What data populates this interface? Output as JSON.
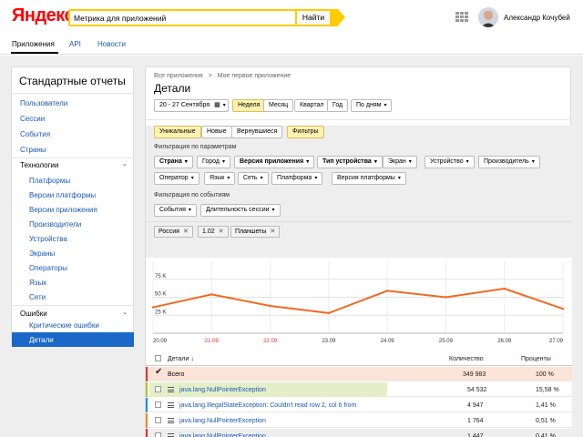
{
  "header": {
    "logo": "Яндекс",
    "search_value": "Метрика для приложений",
    "search_button": "Найти",
    "user_name": "Александр Кочубей"
  },
  "subnav": {
    "items": [
      "Приложения",
      "API",
      "Новости"
    ]
  },
  "sidebar": {
    "title": "Стандартные отчеты",
    "items": [
      "Пользователи",
      "Сессии",
      "События",
      "Страны"
    ],
    "group1": "Технологии",
    "group1_items": [
      "Платформы",
      "Версии платформы",
      "Версии приложения",
      "Производители",
      "Устройства",
      "Экраны",
      "Операторы",
      "Язык",
      "Сети"
    ],
    "group2": "Ошибки",
    "group2_items": [
      "Критические ошибки",
      "Детали"
    ]
  },
  "main": {
    "breadcrumb_1": "Все приложения",
    "breadcrumb_sep": ">",
    "breadcrumb_2": "Мое первое приложение",
    "title": "Детали",
    "date_range": "20 - 27 Сентября",
    "periods": [
      "Неделя",
      "Месяц",
      "Квартал",
      "Год"
    ],
    "active_period": "Неделя",
    "granularity": "По дням",
    "user_types": [
      "Уникальные",
      "Новые",
      "Вернувшиеся"
    ],
    "filters_button": "Фильтры",
    "param_filter_label": "Фильтрация по параметрам",
    "param_filters_row1": [
      "Страна",
      "Город",
      "Версия приложения",
      "Тип устройства",
      "Экран",
      "Устройство",
      "Производитель"
    ],
    "param_filters_row2": [
      "Оператор",
      "Язык",
      "Сеть",
      "Платформа",
      "Версия платформы"
    ],
    "event_filter_label": "Фильтрация по событиям",
    "event_filters": [
      "События",
      "Длительность сессии"
    ],
    "active_chips": [
      "Россия",
      "1.02",
      "Планшеты"
    ]
  },
  "chart_data": {
    "type": "line",
    "x": [
      "20.09",
      "21.09",
      "22.09",
      "23.09",
      "24.09",
      "25.09",
      "26.09",
      "27.09"
    ],
    "weekend_labels": [
      "21.09",
      "22.09"
    ],
    "yticks": [
      "75 K",
      "50 K",
      "25 K"
    ],
    "ylim": [
      0,
      100
    ],
    "series": [
      {
        "values": [
          36,
          54,
          38,
          28,
          59,
          50,
          62,
          34
        ],
        "color": "#f06a24"
      }
    ],
    "grid": true
  },
  "table": {
    "headers": {
      "name": "Детали",
      "count": "Количество",
      "percent": "Проценты"
    },
    "total": {
      "name": "Всего",
      "count": "349 983",
      "percent": "100 %"
    },
    "rows": [
      {
        "name": "java.lang.NullPointerException",
        "count": "54 532",
        "percent": "15,58 %",
        "color": "#a8c820",
        "bar": 0.56
      },
      {
        "name": "java.lang.IllegalStateException: Couldn't read row 2, col 6 from",
        "count": "4 947",
        "percent": "1,41 %",
        "color": "#1a90d8",
        "bar": 0
      },
      {
        "name": "java.lang.NullPointerException",
        "count": "1 764",
        "percent": "0,51 %",
        "color": "#f08a20",
        "bar": 0
      },
      {
        "name": "java.lang.NullPointerException",
        "count": "1 447",
        "percent": "0,41 %",
        "color": "#e03030",
        "bar": 0
      }
    ]
  }
}
